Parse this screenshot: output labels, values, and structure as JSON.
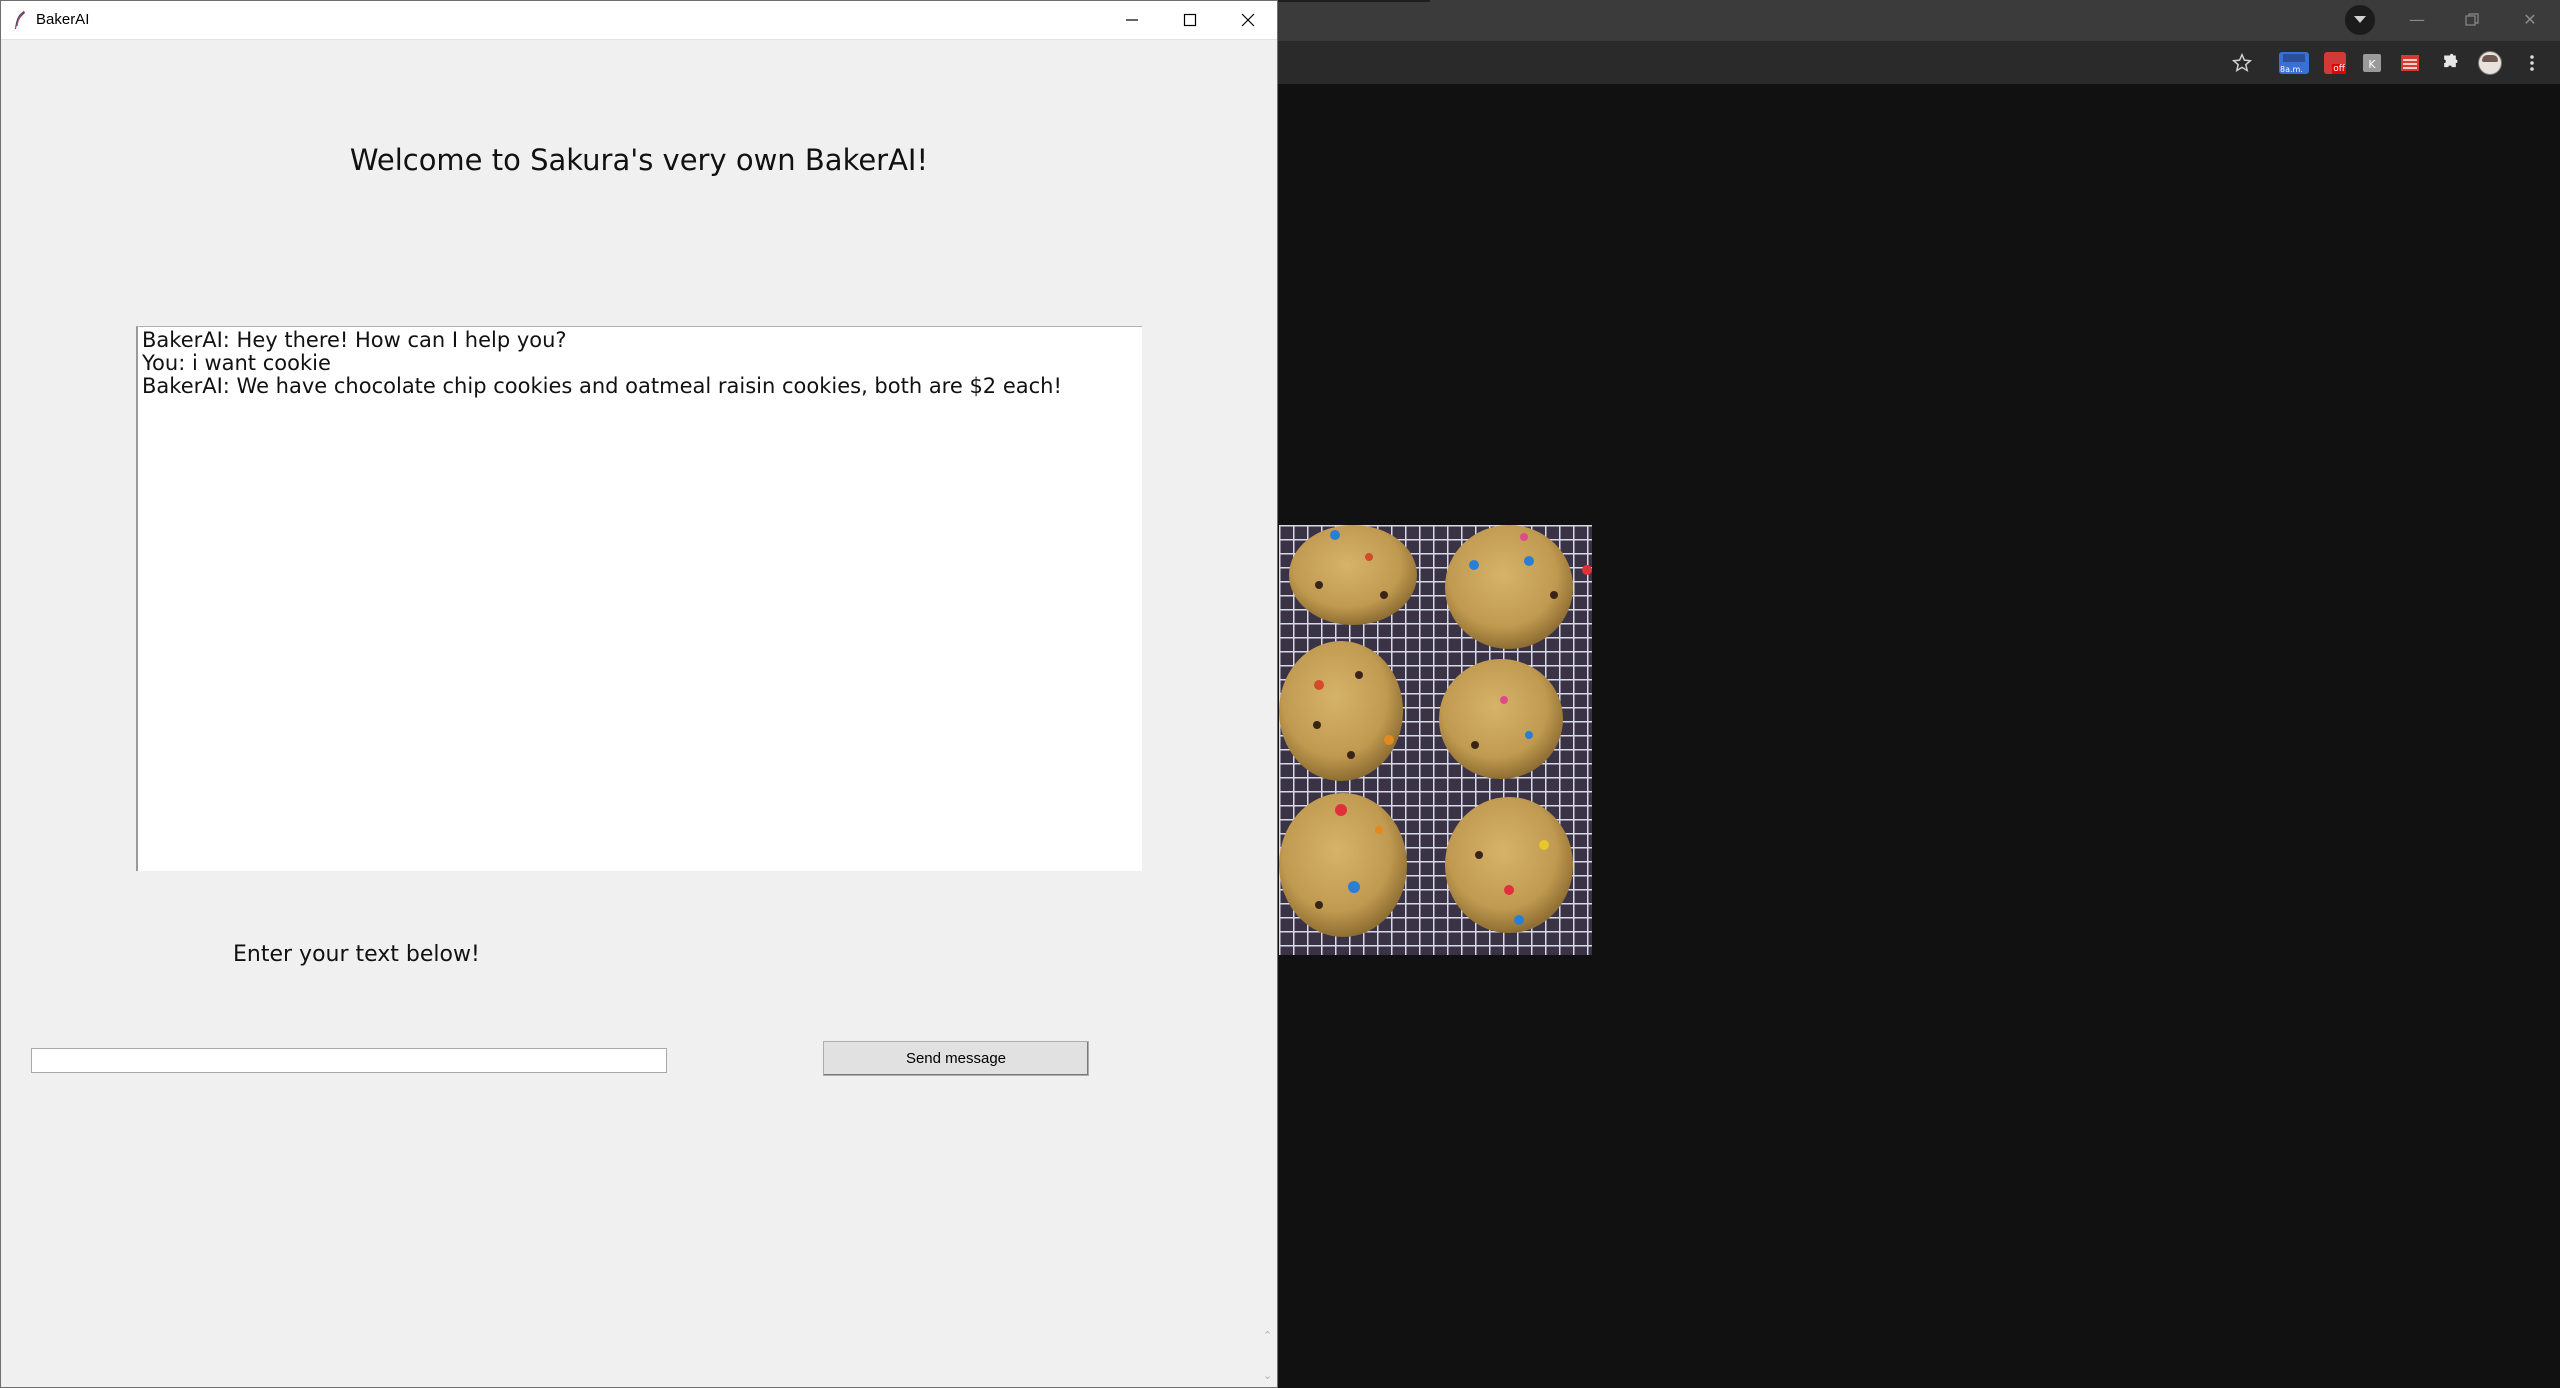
{
  "window": {
    "title": "BakerAI",
    "controls": [
      "minimize",
      "maximize",
      "close"
    ]
  },
  "app": {
    "headline": "Welcome to Sakura's very own BakerAI!",
    "chat_log": [
      "BakerAI: Hey there! How can I help you?",
      "You: i want cookie",
      "BakerAI: We have chocolate chip cookies and oatmeal raisin cookies, both are $2 each!"
    ],
    "prompt_label": "Enter your text below!",
    "input": {
      "value": "",
      "placeholder": ""
    },
    "send_label": "Send message"
  },
  "browser": {
    "toolbar_icons": [
      "bookmark-star-icon",
      "extension-8am-icon",
      "extension-off-icon",
      "extension-k-icon",
      "extension-stack-icon",
      "extensions-puzzle-icon",
      "profile-avatar-icon",
      "menu-kebab-icon"
    ],
    "extension_badges": {
      "ext_8am": "8a.m.",
      "ext_off": "off",
      "ext_k": "K"
    },
    "image_description_icon": "cookies-photo",
    "colors": {
      "background": "#111111",
      "titlebar": "#3b3b3b",
      "toolbar": "#2a2a2a"
    }
  }
}
